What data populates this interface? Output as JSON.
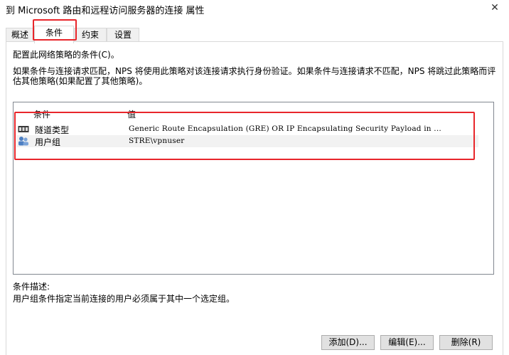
{
  "window": {
    "title": "到 Microsoft 路由和远程访问服务器的连接 属性",
    "close_glyph": "✕"
  },
  "tabs": [
    {
      "label": "概述"
    },
    {
      "label": "条件"
    },
    {
      "label": "约束"
    },
    {
      "label": "设置"
    }
  ],
  "content": {
    "heading": "配置此网络策略的条件(C)。",
    "description": "如果条件与连接请求匹配，NPS 将使用此策略对该连接请求执行身份验证。如果条件与连接请求不匹配，NPS 将跳过此策略而评估其他策略(如果配置了其他策略)。"
  },
  "conditions_list": {
    "columns": [
      "条件",
      "值"
    ],
    "rows": [
      {
        "name": "隧道类型",
        "value": "Generic Route Encapsulation (GRE) OR IP Encapsulating Security Payload in ...",
        "icon": "tunnel-icon"
      },
      {
        "name": "用户组",
        "value": "STRE\\vpnuser",
        "icon": "user-group-icon"
      }
    ]
  },
  "condition_description": {
    "label": "条件描述:",
    "text": "用户组条件指定当前连接的用户必须属于其中一个选定组。"
  },
  "buttons": {
    "add": "添加(D)...",
    "edit": "编辑(E)...",
    "remove": "删除(R)"
  },
  "colors": {
    "highlight": "#e8262b",
    "border": "#d9d9d9",
    "button_bg": "#e1e1e1"
  }
}
